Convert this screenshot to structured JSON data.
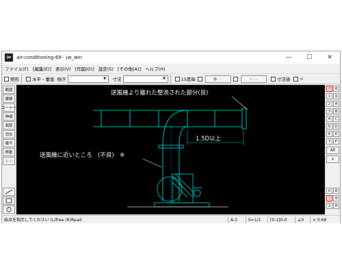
{
  "window": {
    "title": "air-conditioning-69 - jw_win",
    "icon_text": "jw",
    "minimize_glyph": "—",
    "maximize_glyph": "☐",
    "close_glyph": "✕"
  },
  "menu": [
    "ファイル(F)",
    "[編集(E)]",
    "表示(V)",
    "[作図(D)]",
    "設定(S)",
    "[その他(A)]",
    "ヘルプ(H)"
  ],
  "toolbar": {
    "rect_label": "矩形",
    "hv_label": "水平・垂直",
    "tilt_label": "傾き",
    "tilt_value": "",
    "dim_label": "寸法",
    "dim_value": "",
    "deg15_label": "15度毎",
    "circle_btn": "●----",
    "arrow_btn": "<----",
    "dim_value_label": "寸法値",
    "lt_label": "<"
  },
  "left_tools": [
    "範囲",
    "複線",
    "コーナー",
    "伸縮",
    "面取",
    "消去",
    "複写",
    "移動",
    "戻る"
  ],
  "right_panel": {
    "keys_left": [
      "0",
      "1",
      "2",
      "3",
      "4",
      "5",
      "6",
      "7"
    ],
    "keys_right": [
      "8",
      "9",
      "A",
      "B",
      "C",
      "D",
      "E",
      "F"
    ],
    "all_label": "All",
    "x_label": "×",
    "bottom_keys": [
      "0",
      "1",
      "2"
    ],
    "bottom_keys_right": [
      "8",
      "9",
      "A"
    ]
  },
  "drawing": {
    "label_top": "送風機より離れた整流された部分(良)",
    "label_left": "送風機に近いところ　(不良)　※",
    "dim_text": "1.5D以上"
  },
  "status": {
    "message": "始点を指示してください (L)free (R)Read",
    "layer": "A-3",
    "scale": "S=1/1",
    "group": "[0-1]0-0",
    "angle": "∠0",
    "zoom": "× 0.69"
  },
  "colors": {
    "canvas_bg": "#000000",
    "duct_line": "#00ffff",
    "label_line": "#ffffff",
    "dim_line": "#00c8c8",
    "fan_line": "#00e6e6",
    "active_key": "#cc0000"
  }
}
